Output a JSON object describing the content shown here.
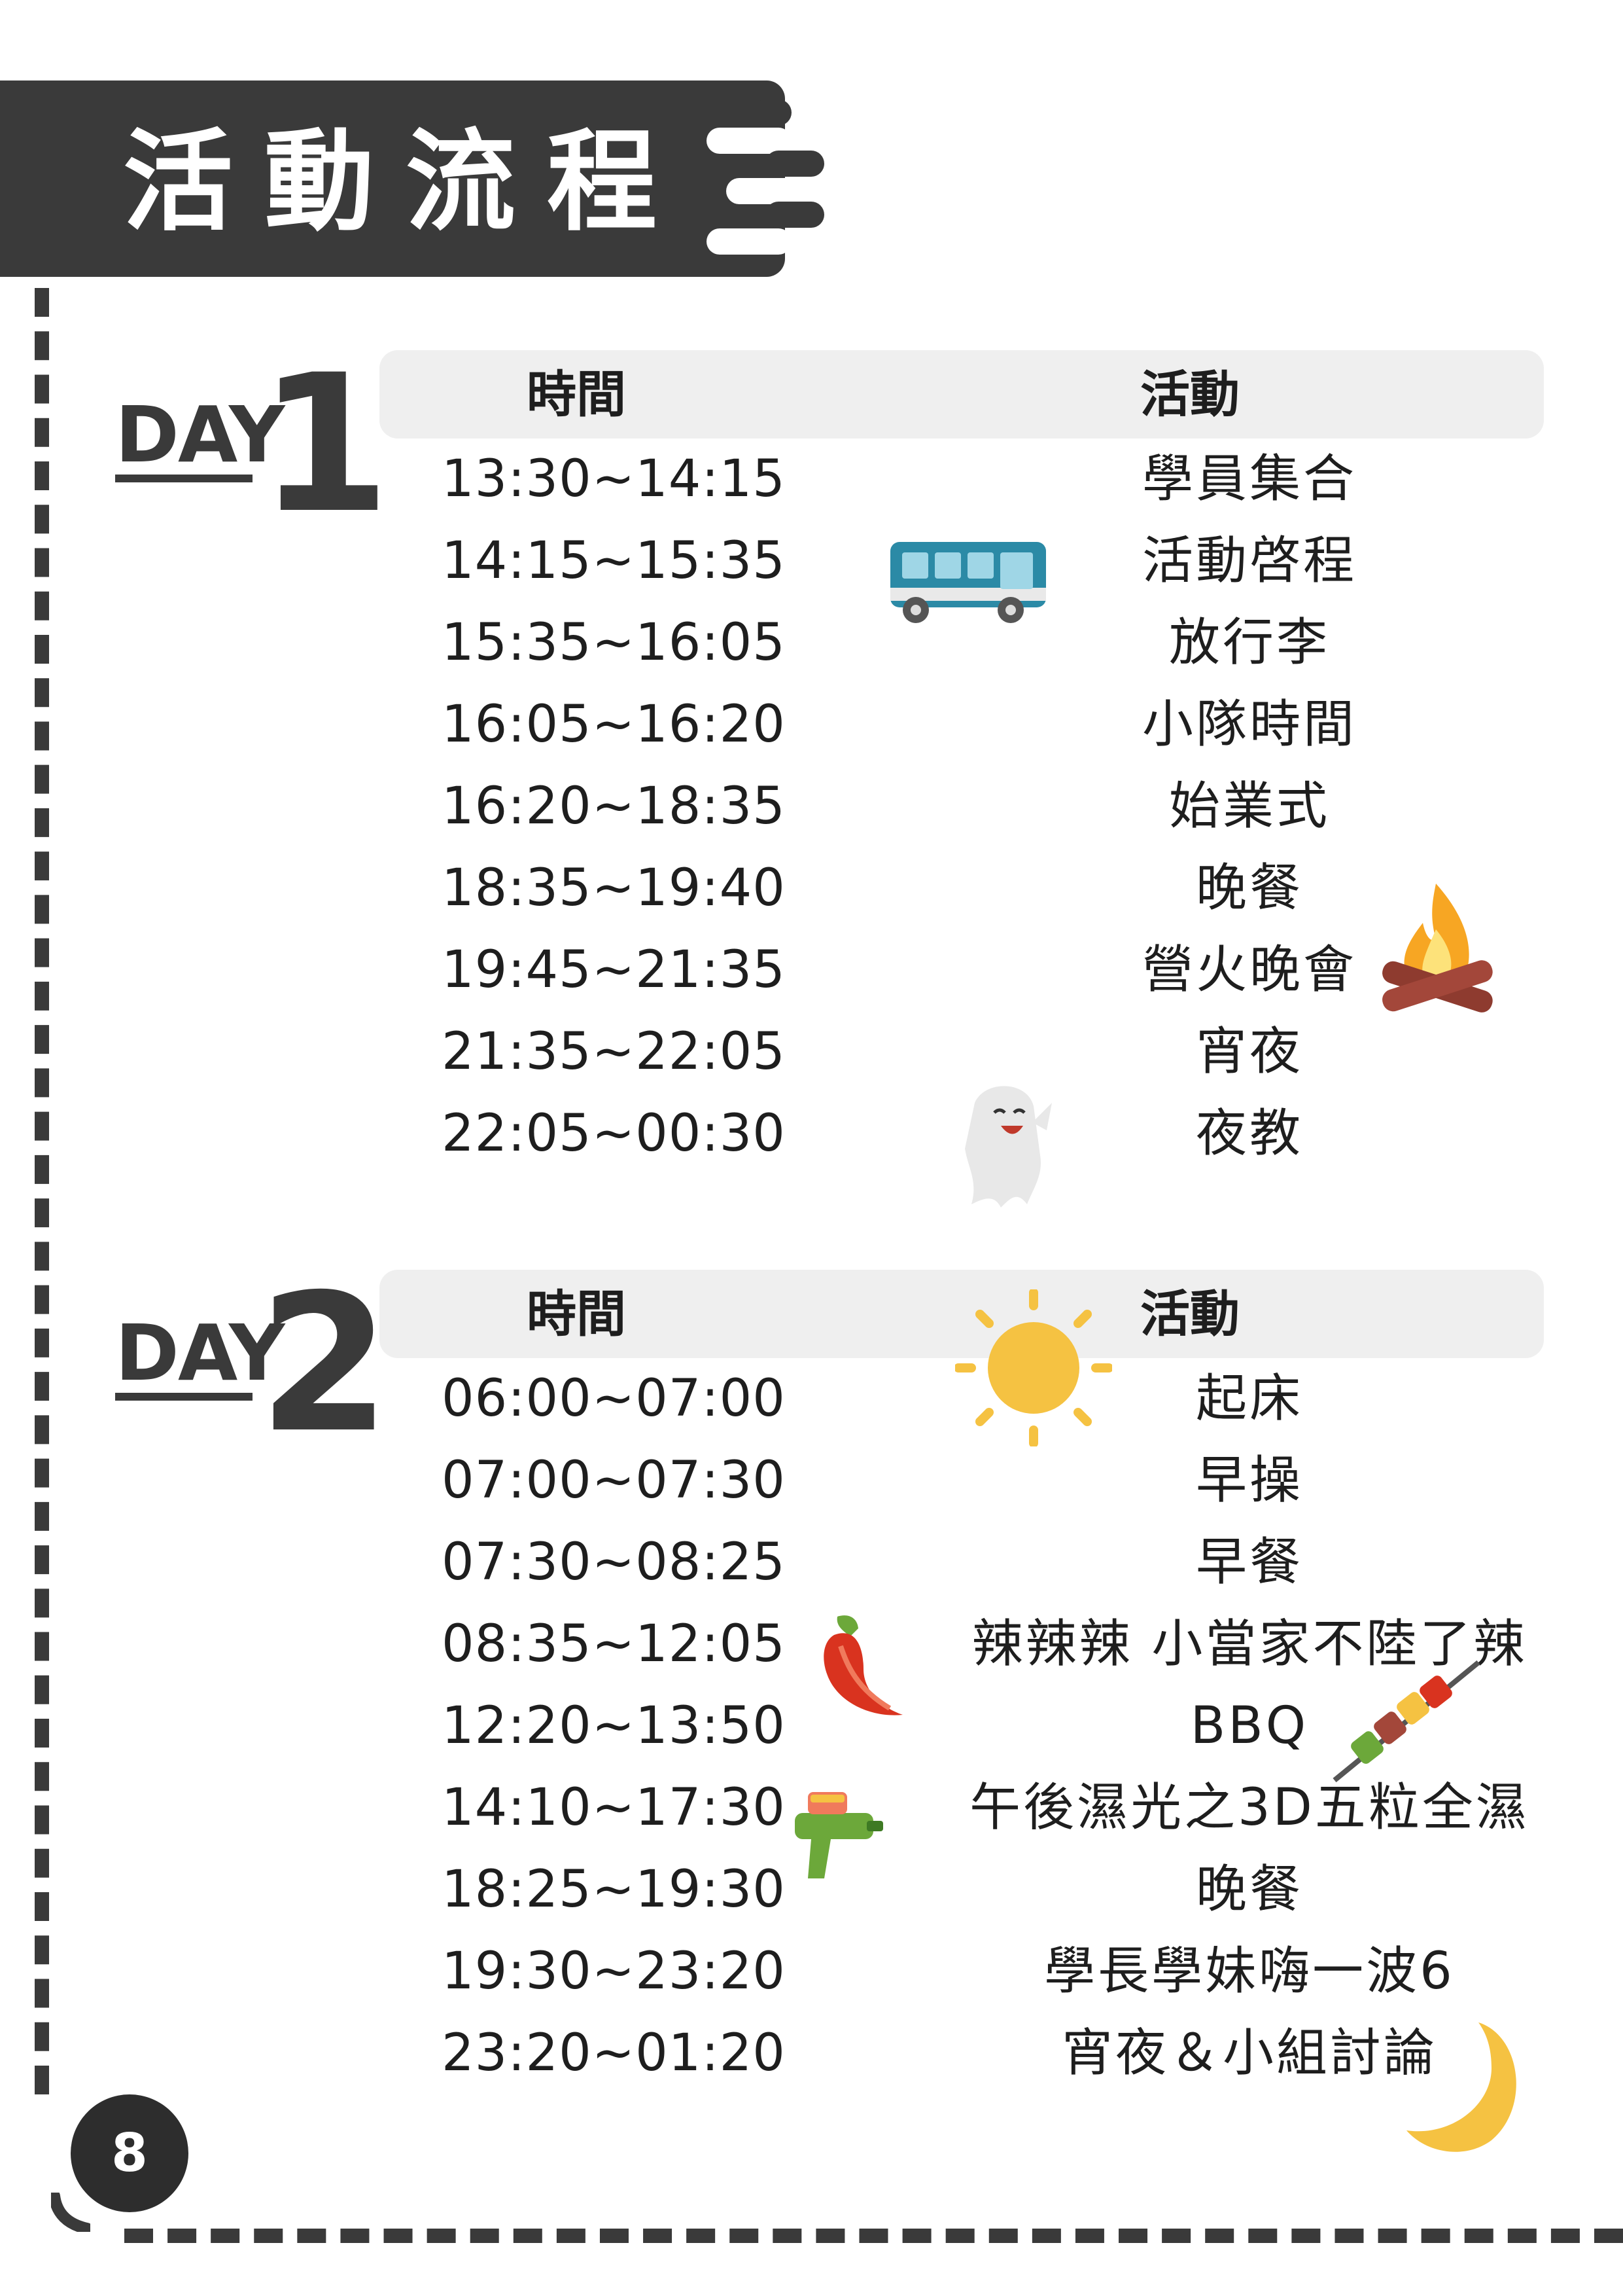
{
  "title": "活動流程",
  "page_number": "8",
  "headers": {
    "time": "時間",
    "activity": "活動"
  },
  "days": [
    {
      "prefix": "DAY",
      "number": "1",
      "rows": [
        {
          "time": "13:30~14:15",
          "activity": "學員集合"
        },
        {
          "time": "14:15~15:35",
          "activity": "活動啓程"
        },
        {
          "time": "15:35~16:05",
          "activity": "放行李"
        },
        {
          "time": "16:05~16:20",
          "activity": "小隊時間"
        },
        {
          "time": "16:20~18:35",
          "activity": "始業式"
        },
        {
          "time": "18:35~19:40",
          "activity": "晚餐"
        },
        {
          "time": "19:45~21:35",
          "activity": "營火晚會"
        },
        {
          "time": "21:35~22:05",
          "activity": "宵夜"
        },
        {
          "time": "22:05~00:30",
          "activity": "夜教"
        }
      ]
    },
    {
      "prefix": "DAY",
      "number": "2",
      "rows": [
        {
          "time": "06:00~07:00",
          "activity": "起床"
        },
        {
          "time": "07:00~07:30",
          "activity": "早操"
        },
        {
          "time": "07:30~08:25",
          "activity": "早餐"
        },
        {
          "time": "08:35~12:05",
          "activity": "辣辣辣 小當家不陸了辣"
        },
        {
          "time": "12:20~13:50",
          "activity": "BBQ"
        },
        {
          "time": "14:10~17:30",
          "activity": "午後濕光之3D五粒全濕"
        },
        {
          "time": "18:25~19:30",
          "activity": "晚餐"
        },
        {
          "time": "19:30~23:20",
          "activity": "學長學妹嗨一波6"
        },
        {
          "time": "23:20~01:20",
          "activity": "宵夜＆小組討論"
        }
      ]
    }
  ],
  "icons": [
    "bus-icon",
    "campfire-icon",
    "ghost-icon",
    "sun-icon",
    "chili-pepper-icon",
    "skewer-icon",
    "water-gun-icon",
    "crescent-moon-icon"
  ],
  "colors": {
    "banner": "#3a3a3a",
    "header_bg": "#efefef",
    "text": "#1e1e1e"
  }
}
